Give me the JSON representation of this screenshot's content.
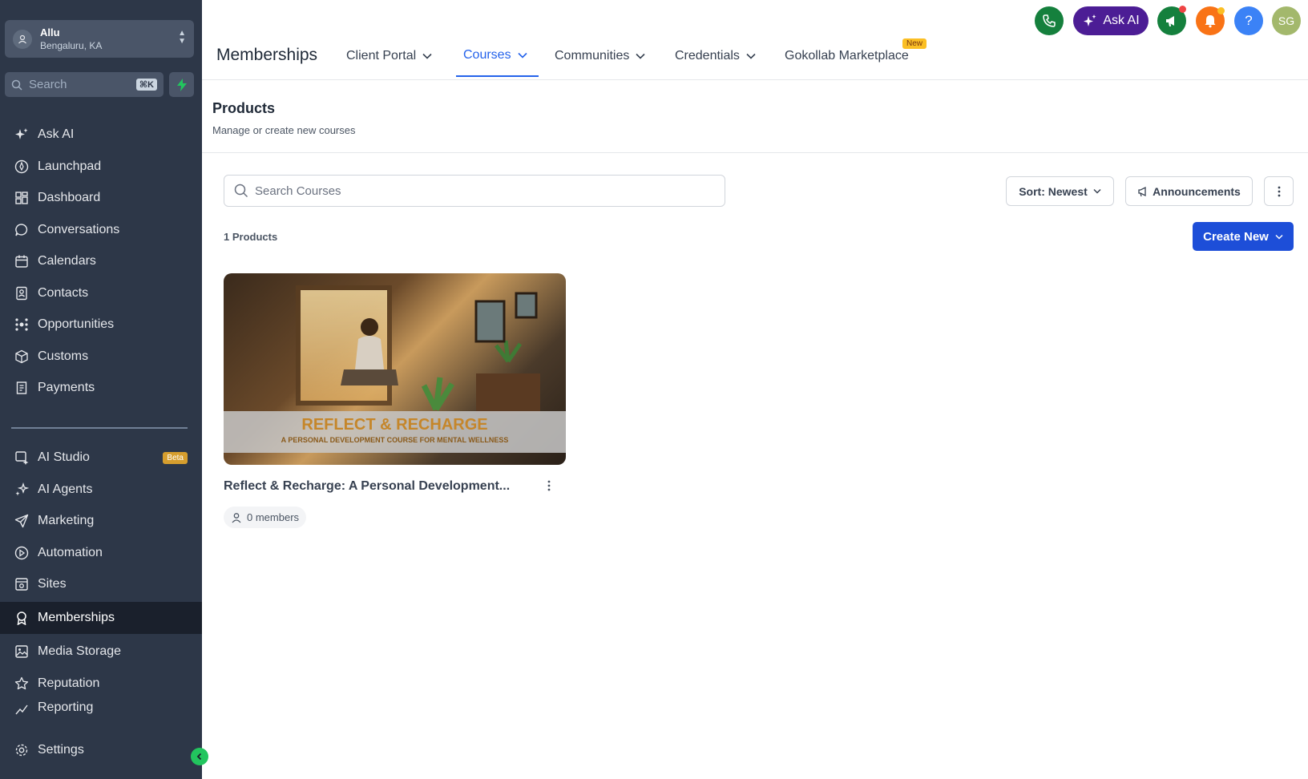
{
  "account": {
    "name": "Allu",
    "location": "Bengaluru, KA"
  },
  "sidebar": {
    "search_placeholder": "Search",
    "search_shortcut": "⌘K",
    "items": [
      {
        "label": "Ask AI",
        "icon": "sparkle-icon"
      },
      {
        "label": "Launchpad",
        "icon": "rocket-icon"
      },
      {
        "label": "Dashboard",
        "icon": "dashboard-icon"
      },
      {
        "label": "Conversations",
        "icon": "chat-icon"
      },
      {
        "label": "Calendars",
        "icon": "calendar-icon"
      },
      {
        "label": "Contacts",
        "icon": "contacts-icon"
      },
      {
        "label": "Opportunities",
        "icon": "opportunities-icon"
      },
      {
        "label": "Customs",
        "icon": "cube-icon"
      },
      {
        "label": "Payments",
        "icon": "receipt-icon"
      }
    ],
    "items2": [
      {
        "label": "AI Studio",
        "icon": "ai-studio-icon",
        "badge": "Beta"
      },
      {
        "label": "AI Agents",
        "icon": "agents-icon"
      },
      {
        "label": "Marketing",
        "icon": "send-icon"
      },
      {
        "label": "Automation",
        "icon": "automation-icon"
      },
      {
        "label": "Sites",
        "icon": "sites-icon"
      },
      {
        "label": "Memberships",
        "icon": "award-icon",
        "active": true
      },
      {
        "label": "Media Storage",
        "icon": "image-icon"
      },
      {
        "label": "Reputation",
        "icon": "star-icon"
      },
      {
        "label": "Reporting",
        "icon": "chart-icon"
      }
    ],
    "settings": "Settings"
  },
  "header": {
    "title": "Memberships",
    "tabs": [
      {
        "label": "Client Portal"
      },
      {
        "label": "Courses",
        "active": true
      },
      {
        "label": "Communities"
      },
      {
        "label": "Credentials"
      },
      {
        "label": "Gokollab Marketplace",
        "badge": "New"
      }
    ],
    "ask_ai": "Ask AI",
    "help": "?",
    "user_initials": "SG"
  },
  "main": {
    "title": "Products",
    "subtitle": "Manage or create new courses",
    "search_placeholder": "Search Courses",
    "sort_label": "Sort: Newest",
    "announcements_label": "Announcements",
    "count_label": "1 Products",
    "create_label": "Create New",
    "course": {
      "banner_title": "REFLECT & RECHARGE",
      "banner_subtitle": "A PERSONAL DEVELOPMENT COURSE FOR MENTAL WELLNESS",
      "title": "Reflect & Recharge: A Personal Development...",
      "members": "0 members"
    }
  },
  "colors": {
    "sidebar": "#2d3748",
    "accent": "#2563eb",
    "primary_button": "#1d4ed8"
  }
}
